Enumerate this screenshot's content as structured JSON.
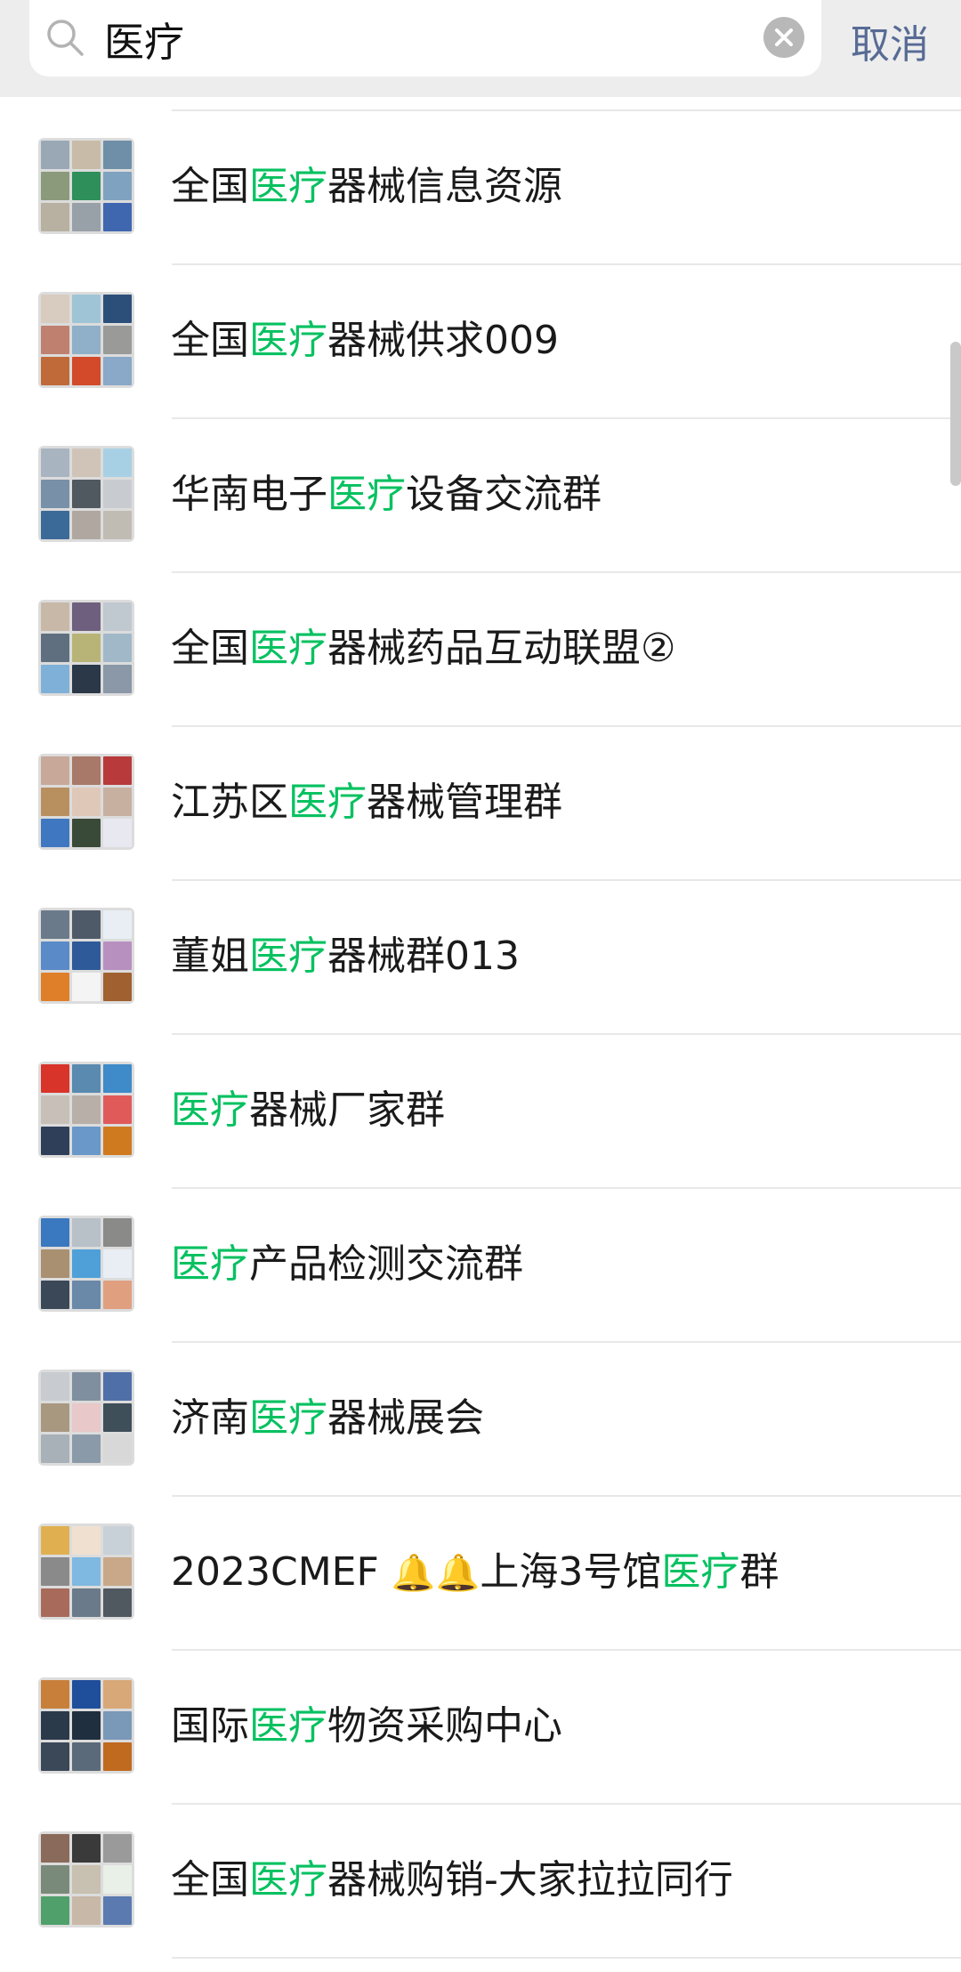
{
  "search": {
    "query": "医疗",
    "cancel_label": "取消",
    "highlight_color": "#07c160",
    "link_color": "#576b95"
  },
  "results": [
    {
      "parts": [
        "全国",
        "医疗",
        "器械信息资源"
      ],
      "avatar": [
        "#9aa8b6",
        "#c8bca8",
        "#6f8fa8",
        "#8a9a7a",
        "#2f8f5a",
        "#7fa2c0",
        "#b8b0a0",
        "#98a0a8",
        "#3f67b0"
      ]
    },
    {
      "parts": [
        "全国",
        "医疗",
        "器械供求009"
      ],
      "avatar": [
        "#d8ccc0",
        "#9fc4d6",
        "#2c4f7a",
        "#c08070",
        "#8fb0c8",
        "#9a9a98",
        "#c06a3a",
        "#d24a2a",
        "#8aa8c8"
      ]
    },
    {
      "parts": [
        "华南电子",
        "医疗",
        "设备交流群"
      ],
      "avatar": [
        "#a8b4c0",
        "#d0c4b8",
        "#a8d0e4",
        "#7890a8",
        "#505860",
        "#c8ccd0",
        "#3c6a98",
        "#b0a8a0",
        "#c0bcb4"
      ]
    },
    {
      "parts": [
        "全国",
        "医疗",
        "器械药品互动联盟②"
      ],
      "avatar": [
        "#c8b8a8",
        "#6f5f7f",
        "#c0c8d0",
        "#5f6f7f",
        "#b8b478",
        "#a0b8c8",
        "#7fb0d8",
        "#2a3848",
        "#8a98a8"
      ]
    },
    {
      "parts": [
        "江苏区",
        "医疗",
        "器械管理群"
      ],
      "avatar": [
        "#c8a898",
        "#a87868",
        "#b83a3a",
        "#b89060",
        "#e0c8b8",
        "#c8b0a0",
        "#3f78c0",
        "#3a4a38",
        "#e8e8f0"
      ]
    },
    {
      "parts": [
        "董姐",
        "医疗",
        "器械群013"
      ],
      "avatar": [
        "#6a7a8a",
        "#4f5a68",
        "#e8eef4",
        "#5a8ac8",
        "#2f5a9a",
        "#b890c0",
        "#e07f2a",
        "#f4f4f4",
        "#a06030"
      ]
    },
    {
      "parts": [
        "",
        "医疗",
        "器械厂家群"
      ],
      "avatar": [
        "#d8342a",
        "#5a8ab0",
        "#3f8ac8",
        "#c8c0b8",
        "#b8b0a8",
        "#e05a5a",
        "#2f3f5a",
        "#6a98c8",
        "#d07a20"
      ]
    },
    {
      "parts": [
        "",
        "医疗",
        "产品检测交流群"
      ],
      "avatar": [
        "#3a78c0",
        "#b8c0c8",
        "#8a8a88",
        "#a89070",
        "#4fa0d8",
        "#e8eef4",
        "#3a4858",
        "#6a88a8",
        "#e0a080"
      ]
    },
    {
      "parts": [
        "济南",
        "医疗",
        "器械展会"
      ],
      "avatar": [
        "#c8ccd0",
        "#7f8f9f",
        "#4f6fa8",
        "#a89880",
        "#e8c8c8",
        "#3f4f5a",
        "#a8b0b8",
        "#8a9aa8",
        "#d8d8d8"
      ]
    },
    {
      "parts": [
        "2023CMEF ",
        "",
        "上海3号馆",
        "医疗",
        "群"
      ],
      "bells": true,
      "avatar": [
        "#e0b050",
        "#f0e0d0",
        "#c8d0d8",
        "#8a8a8a",
        "#7fb8e0",
        "#c8a888",
        "#a86a5a",
        "#6a7a8a",
        "#505860"
      ]
    },
    {
      "parts": [
        "国际",
        "医疗",
        "物资采购中心"
      ],
      "avatar": [
        "#c87f3a",
        "#1f4f9a",
        "#d8a878",
        "#2a3a4a",
        "#1f2f3f",
        "#7a98b8",
        "#3a4858",
        "#5a6a7a",
        "#c06a20"
      ]
    },
    {
      "parts": [
        "全国",
        "医疗",
        "器械购销-大家拉拉同行"
      ],
      "avatar": [
        "#8a6a5a",
        "#3a3a3a",
        "#9a9a9a",
        "#7a8a7a",
        "#c8c0b0",
        "#e8f0e8",
        "#4fa06a",
        "#c8b8a8",
        "#5a7ab0"
      ]
    }
  ]
}
